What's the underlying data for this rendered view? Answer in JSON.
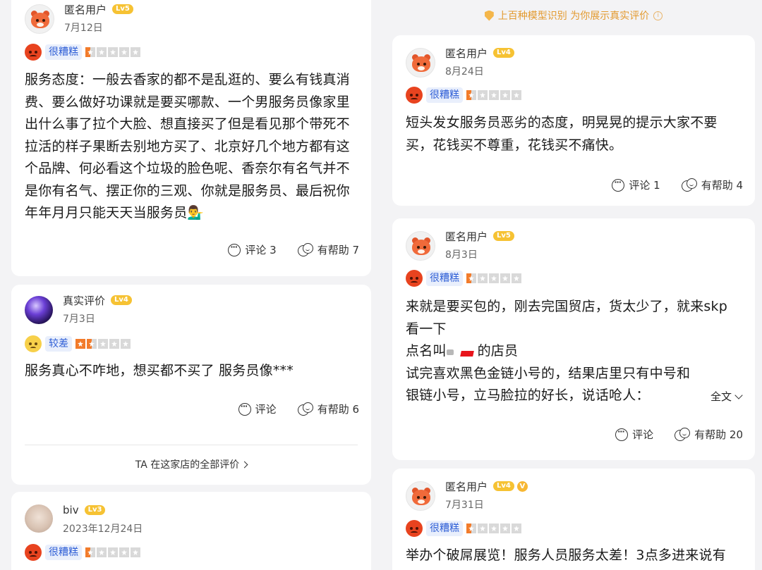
{
  "leftColumn": {
    "reviews": [
      {
        "name": "匿名用户",
        "level": "Lv5",
        "date": "7月12日",
        "ratingText": "很糟糕",
        "body": "服务态度：一般去香家的都不是乱逛的、要么有钱真消费、要么做好功课就是要买哪款、一个男服务员像家里出什么事了拉个大脸、想直接买了但是看见那个带死不拉活的样子果断去别地方买了、北京好几个地方都有这个品牌、何必看这个垃圾的脸色呢、香奈尔有名气并不是你有名气、摆正你的三观、你就是服务员、最后祝你年年月月只能天天当服务员💁‍♂️",
        "comment": "评论 3",
        "helpful": "有帮助 7"
      },
      {
        "name": "真实评价",
        "level": "Lv4",
        "date": "7月3日",
        "ratingText": "较差",
        "body": "服务真心不咋地，想买都不买了 服务员像***",
        "comment": "评论",
        "helpful": "有帮助 6",
        "allReviews": "TA 在这家店的全部评价"
      },
      {
        "name": "biv",
        "level": "Lv3",
        "date": "2023年12月24日",
        "ratingText": "很糟糕"
      }
    ]
  },
  "rightColumn": {
    "banner": "上百种模型识别 为你展示真实评价",
    "reviews": [
      {
        "name": "匿名用户",
        "level": "Lv4",
        "date": "8月24日",
        "ratingText": "很糟糕",
        "body": "短头发女服务员恶劣的态度，明晃晃的提示大家不要买，花钱买不尊重，花钱买不痛快。",
        "comment": "评论 1",
        "helpful": "有帮助 4"
      },
      {
        "name": "匿名用户",
        "level": "Lv5",
        "date": "8月3日",
        "ratingText": "很糟糕",
        "line1": "来就是要买包的，刚去完国贸店，货太少了，就来skp",
        "line2": "看一下",
        "line3a": "点名叫",
        "line3b": "的店员",
        "line4": "试完喜欢黑色金链小号的，结果店里只有中号和银链小号，立马脸拉的好长，说话呛人：",
        "fullText": "全文",
        "comment": "评论",
        "helpful": "有帮助 20"
      },
      {
        "name": "匿名用户",
        "level": "Lv4",
        "verifiedBadge": "V",
        "date": "7月31日",
        "ratingText": "很糟糕",
        "body": "举办个破屌展览！服务人员服务太差！3点多进来说有"
      }
    ]
  }
}
